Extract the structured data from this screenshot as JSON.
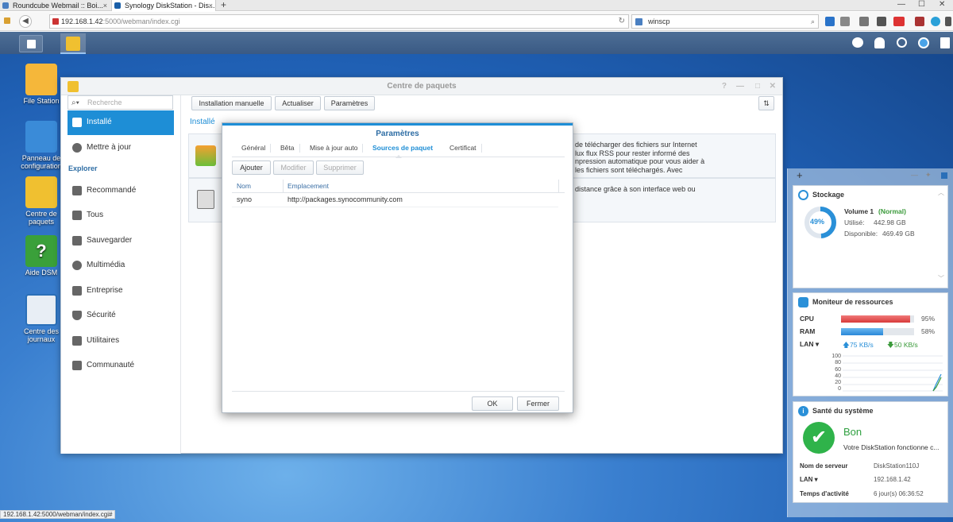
{
  "browser": {
    "tabs": [
      {
        "title": "Roundcube Webmail :: Boi...",
        "close": "×"
      },
      {
        "title": "Synology DiskStation - Dis...",
        "close": "×"
      }
    ],
    "new_tab": "+",
    "window_controls": [
      "—",
      "☐",
      "✕"
    ],
    "url_host": "192.168.1.42",
    "url_rest": ":5000/webman/index.cgi",
    "search_value": "winscp",
    "status_url": "192.168.1.42:5000/webman/index.cgi#"
  },
  "desktop": {
    "icons": [
      {
        "label": "File Station",
        "color": "#f5b73a"
      },
      {
        "label": "Panneau de configuration",
        "color": "#3a8bd8"
      },
      {
        "label": "Centre de paquets",
        "color": "#f0c030"
      },
      {
        "label": "Aide DSM",
        "color": "#3aa03a"
      },
      {
        "label": "Centre des journaux",
        "color": "#e8eef5"
      }
    ]
  },
  "package_center": {
    "title": "Centre de paquets",
    "search_placeholder": "Recherche",
    "sidebar": {
      "items": [
        {
          "label": "Installé",
          "active": true
        },
        {
          "label": "Mettre à jour"
        }
      ],
      "explore_heading": "Explorer",
      "explore_items": [
        {
          "label": "Recommandé"
        },
        {
          "label": "Tous"
        },
        {
          "label": "Sauvegarder"
        },
        {
          "label": "Multimédia"
        },
        {
          "label": "Entreprise"
        },
        {
          "label": "Sécurité"
        },
        {
          "label": "Utilitaires"
        },
        {
          "label": "Communauté"
        }
      ]
    },
    "toolbar": {
      "manual_install": "Installation manuelle",
      "refresh": "Actualiser",
      "settings": "Paramètres"
    },
    "section_title": "Installé",
    "packages": [
      {
        "desc_lines": [
          "de télécharger des fichiers sur Internet",
          "lux flux RSS pour rester informé des",
          "npression automatique pour vous aider à",
          "les fichiers sont téléchargés. Avec"
        ]
      },
      {
        "desc_lines": [
          "distance grâce à son interface web ou"
        ]
      }
    ]
  },
  "dialog": {
    "title": "Paramètres",
    "tabs": [
      "Général",
      "Bêta",
      "Mise à jour auto",
      "Sources de paquet",
      "Certificat"
    ],
    "active_tab": "Sources de paquet",
    "buttons": {
      "add": "Ajouter",
      "edit": "Modifier",
      "delete": "Supprimer"
    },
    "columns": [
      "Nom",
      "Emplacement"
    ],
    "rows": [
      {
        "name": "syno",
        "location": "http://packages.synocommunity.com"
      }
    ],
    "ok": "OK",
    "close": "Fermer"
  },
  "widgets": {
    "add": "+",
    "storage": {
      "title": "Stockage",
      "percent_label": "49%",
      "percent": 49,
      "volume": "Volume 1",
      "status": "(Normal)",
      "used_label": "Utilisé:",
      "used": "442.98 GB",
      "available_label": "Disponible:",
      "available": "469.49 GB"
    },
    "resources": {
      "title": "Moniteur de ressources",
      "cpu_label": "CPU",
      "cpu": "95%",
      "cpu_value": 95,
      "ram_label": "RAM",
      "ram": "58%",
      "ram_value": 58,
      "lan_label": "LAN ▾",
      "up": "75 KB/s",
      "down": "50 KB/s",
      "axis_ticks": [
        "100",
        "80",
        "60",
        "40",
        "20",
        "0"
      ]
    },
    "health": {
      "title": "Santé du système",
      "status": "Bon",
      "message": "Votre DiskStation fonctionne c...",
      "server_name_label": "Nom de serveur",
      "server_name": "DiskStation110J",
      "lan_label": "LAN ▾",
      "lan_ip": "192.168.1.42",
      "uptime_label": "Temps d'activité",
      "uptime": "6 jour(s) 06:36:52"
    }
  }
}
